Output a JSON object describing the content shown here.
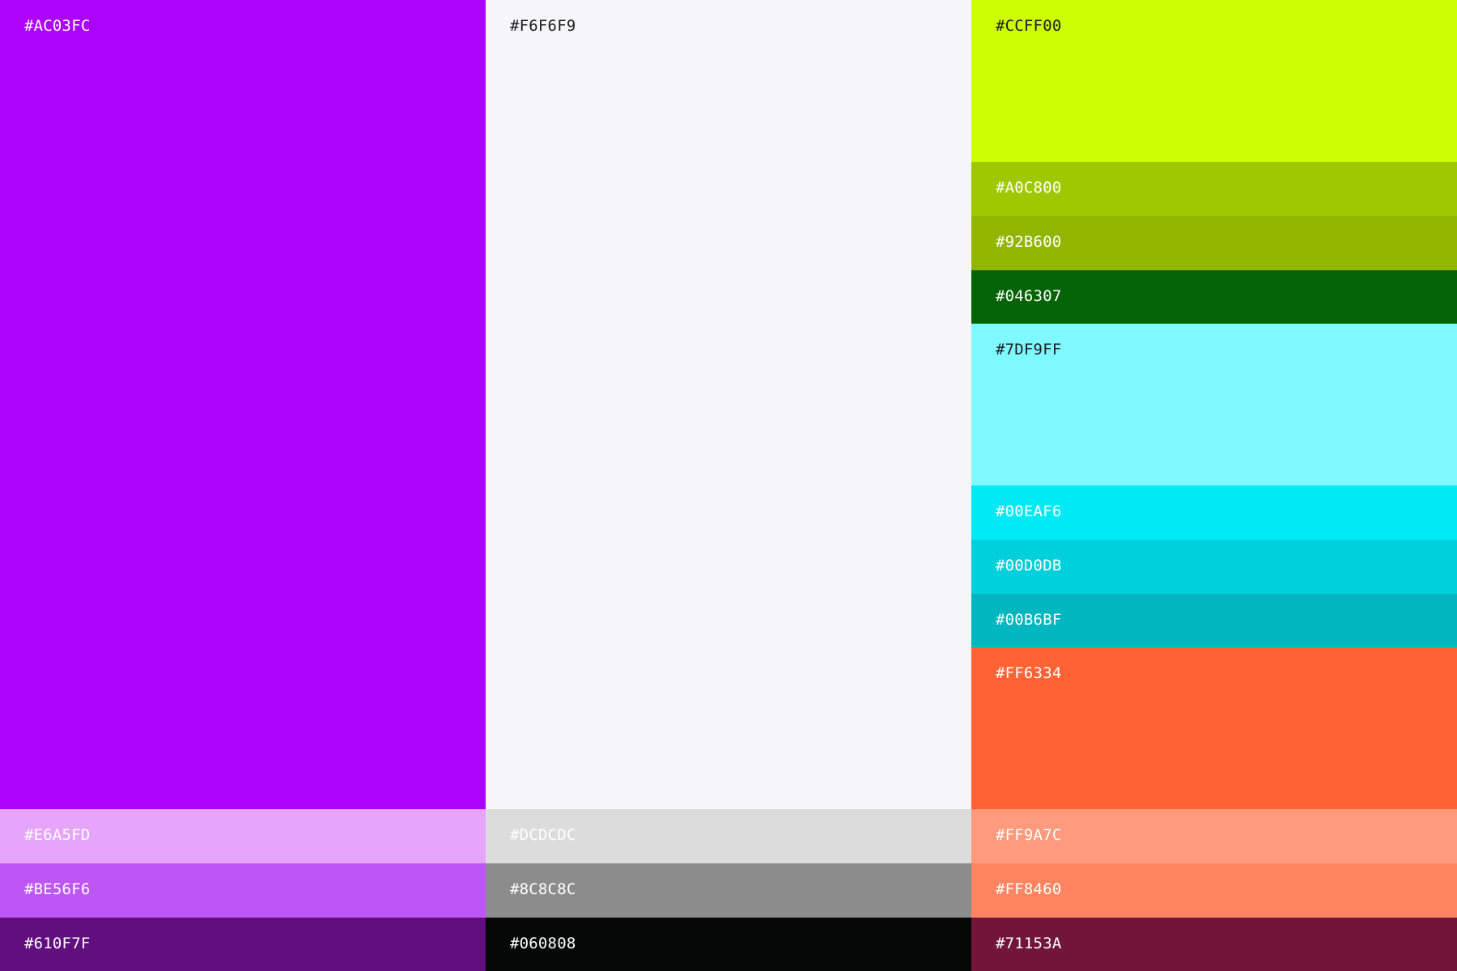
{
  "columns": [
    {
      "swatches": [
        {
          "hex": "#AC03FC",
          "label": "#AC03FC"
        },
        {
          "hex": "#E6A5FD",
          "label": "#E6A5FD"
        },
        {
          "hex": "#BE56F6",
          "label": "#BE56F6"
        },
        {
          "hex": "#610F7F",
          "label": "#610F7F"
        }
      ]
    },
    {
      "swatches": [
        {
          "hex": "#F6F6F9",
          "label": "#F6F6F9"
        },
        {
          "hex": "#DCDCDC",
          "label": "#DCDCDC"
        },
        {
          "hex": "#8C8C8C",
          "label": "#8C8C8C"
        },
        {
          "hex": "#060808",
          "label": "#060808"
        }
      ]
    },
    {
      "swatches": [
        {
          "hex": "#CCFF00",
          "label": "#CCFF00"
        },
        {
          "hex": "#A0C800",
          "label": "#A0C800"
        },
        {
          "hex": "#92B600",
          "label": "#92B600"
        },
        {
          "hex": "#046307",
          "label": "#046307"
        },
        {
          "hex": "#7DF9FF",
          "label": "#7DF9FF"
        },
        {
          "hex": "#00EAF6",
          "label": "#00EAF6"
        },
        {
          "hex": "#00D0DB",
          "label": "#00D0DB"
        },
        {
          "hex": "#00B6BF",
          "label": "#00B6BF"
        },
        {
          "hex": "#FF6334",
          "label": "#FF6334"
        },
        {
          "hex": "#FF9A7C",
          "label": "#FF9A7C"
        },
        {
          "hex": "#FF8460",
          "label": "#FF8460"
        },
        {
          "hex": "#71153A",
          "label": "#71153A"
        }
      ]
    }
  ]
}
